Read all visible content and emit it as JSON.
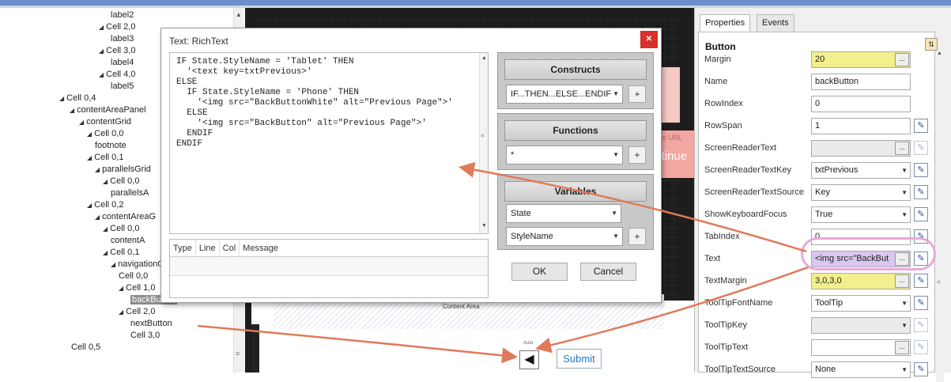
{
  "tree": {
    "rows": [
      {
        "label": "label2",
        "indent": 0,
        "arrow": ""
      },
      {
        "label": "Cell 2,0",
        "arrow": "◢"
      },
      {
        "label": "label3",
        "arrow": ""
      },
      {
        "label": "Cell 3,0",
        "arrow": "◢"
      },
      {
        "label": "label4",
        "arrow": ""
      },
      {
        "label": "Cell 4,0",
        "arrow": "◢"
      },
      {
        "label": "label5",
        "arrow": ""
      },
      {
        "label": "Cell 0,4",
        "arrow": "◢"
      },
      {
        "label": "contentAreaPanel",
        "arrow": "◢"
      },
      {
        "label": "contentGrid",
        "arrow": "◢"
      },
      {
        "label": "Cell 0,0",
        "arrow": "◢"
      },
      {
        "label": "footnote",
        "arrow": ""
      },
      {
        "label": "Cell 0,1",
        "arrow": "◢"
      },
      {
        "label": "parallelsGrid",
        "arrow": "◢"
      },
      {
        "label": "Cell 0,0",
        "arrow": "◢"
      },
      {
        "label": "parallelsA",
        "arrow": ""
      },
      {
        "label": "Cell 0,2",
        "arrow": "◢"
      },
      {
        "label": "contentAreaG",
        "arrow": "◢"
      },
      {
        "label": "Cell 0,0",
        "arrow": "◢"
      },
      {
        "label": "contentA",
        "arrow": ""
      },
      {
        "label": "Cell 0,1",
        "arrow": "◢"
      },
      {
        "label": "navigationGrid",
        "arrow": "◢"
      },
      {
        "label": "Cell 0,0",
        "arrow": ""
      },
      {
        "label": "Cell 1,0",
        "arrow": "◢"
      },
      {
        "label": "backButton",
        "arrow": ""
      },
      {
        "label": "Cell 2,0",
        "arrow": "◢"
      },
      {
        "label": "nextButton",
        "arrow": ""
      },
      {
        "label": "Cell 3,0",
        "arrow": ""
      },
      {
        "label": "Cell 0,5",
        "arrow": ""
      }
    ]
  },
  "canvas": {
    "hint_text": "the URL",
    "continue_text": "ontinue",
    "content_area_label": "Content Area",
    "back_button_glyph": "◀",
    "back_button_tag": "Auto",
    "back_button_side": "Auto",
    "submit_label": "Submit"
  },
  "dialog": {
    "title": "Text: RichText",
    "close_glyph": "✕",
    "code_lines": [
      "IF State.StyleName = 'Tablet' THEN",
      "  '<text key=txtPrevious>'",
      "ELSE",
      "  IF State.StyleName = 'Phone' THEN",
      "    '<img src=\"BackButtonWhite\" alt=\"Previous Page\">'",
      "  ELSE",
      "    '<img src=\"BackButton\" alt=\"Previous Page\">'",
      "  ENDIF",
      "ENDIF"
    ],
    "message_columns": [
      "Type",
      "Line",
      "Col",
      "Message"
    ],
    "constructs": {
      "title": "Constructs",
      "selected": "IF...THEN...ELSE...ENDIF",
      "add": "+"
    },
    "functions": {
      "title": "Functions",
      "selected": "*",
      "add": "+"
    },
    "variables": {
      "title": "Variables",
      "selected_1": "State",
      "selected_2": "StyleName",
      "add": "+"
    },
    "ok_label": "OK",
    "cancel_label": "Cancel"
  },
  "properties": {
    "tabs": [
      "Properties",
      "Events"
    ],
    "heading": "Button",
    "rows": [
      {
        "name": "Margin",
        "value": "20",
        "style": "yellow",
        "ellipsis": true
      },
      {
        "name": "Name",
        "value": "backButton",
        "style": "",
        "ellipsis": false
      },
      {
        "name": "RowIndex",
        "value": "0",
        "style": "",
        "ellipsis": false
      },
      {
        "name": "RowSpan",
        "value": "1",
        "style": "",
        "ellipsis": false,
        "edit": true
      },
      {
        "name": "ScreenReaderText",
        "value": "",
        "style": "disabled",
        "ellipsis": true,
        "edit": true,
        "faded": true
      },
      {
        "name": "ScreenReaderTextKey",
        "value": "txtPrevious",
        "style": "",
        "dropdown": true,
        "edit": true
      },
      {
        "name": "ScreenReaderTextSource",
        "value": "Key",
        "style": "",
        "dropdown": true,
        "edit": true
      },
      {
        "name": "ShowKeyboardFocus",
        "value": "True",
        "style": "",
        "dropdown": true,
        "edit": true
      },
      {
        "name": "TabIndex",
        "value": "0",
        "style": "",
        "edit": true
      },
      {
        "name": "Text",
        "value": "<img src=\"BackBut",
        "style": "purple",
        "ellipsis": true,
        "edit": true
      },
      {
        "name": "TextMargin",
        "value": "3,0,3,0",
        "style": "yellow",
        "ellipsis": true,
        "edit": true
      },
      {
        "name": "ToolTipFontName",
        "value": "ToolTip",
        "style": "",
        "dropdown": true,
        "edit": true
      },
      {
        "name": "ToolTipKey",
        "value": "",
        "style": "disabled",
        "dropdown": true,
        "edit": true,
        "faded": true
      },
      {
        "name": "ToolTipText",
        "value": "",
        "style": "",
        "ellipsis": true,
        "edit": true,
        "faded": true
      },
      {
        "name": "ToolTipTextSource",
        "value": "None",
        "style": "",
        "dropdown": true,
        "edit": true
      }
    ]
  },
  "colors": {
    "arrow": "#e07a5a",
    "accent": "#6d8fc7",
    "highlight": "#e8a9d8"
  }
}
